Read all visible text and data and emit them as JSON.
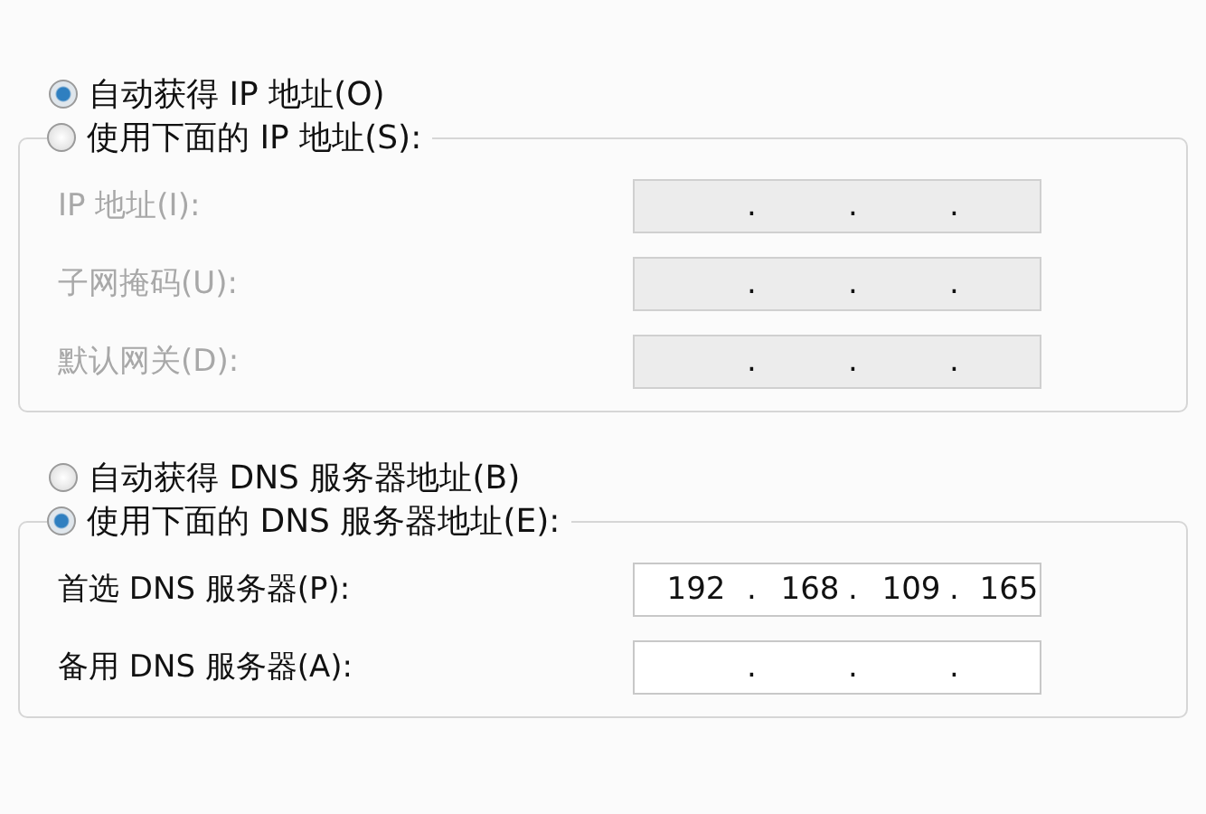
{
  "sections": [
    {
      "auto_option": {
        "label": "自动获得 IP 地址(O)",
        "selected": true
      },
      "manual_option": {
        "label": "使用下面的 IP 地址(S):",
        "selected": false
      },
      "fields": [
        {
          "label": "IP 地址(I):",
          "disabled": true,
          "dots": [
            ".",
            ".",
            "."
          ]
        },
        {
          "label": "子网掩码(U):",
          "disabled": true,
          "dots": [
            ".",
            ".",
            "."
          ]
        },
        {
          "label": "默认网关(D):",
          "disabled": true,
          "dots": [
            ".",
            ".",
            "."
          ]
        }
      ]
    },
    {
      "auto_option": {
        "label": "自动获得 DNS 服务器地址(B)",
        "selected": false
      },
      "manual_option": {
        "label": "使用下面的 DNS 服务器地址(E):",
        "selected": true
      },
      "fields": [
        {
          "label": "首选 DNS 服务器(P):",
          "disabled": false,
          "dots": [
            ".",
            ".",
            "."
          ],
          "octets": [
            "192",
            "168",
            "109",
            "165"
          ]
        },
        {
          "label": "备用 DNS 服务器(A):",
          "disabled": false,
          "dots": [
            ".",
            ".",
            "."
          ]
        }
      ]
    }
  ]
}
